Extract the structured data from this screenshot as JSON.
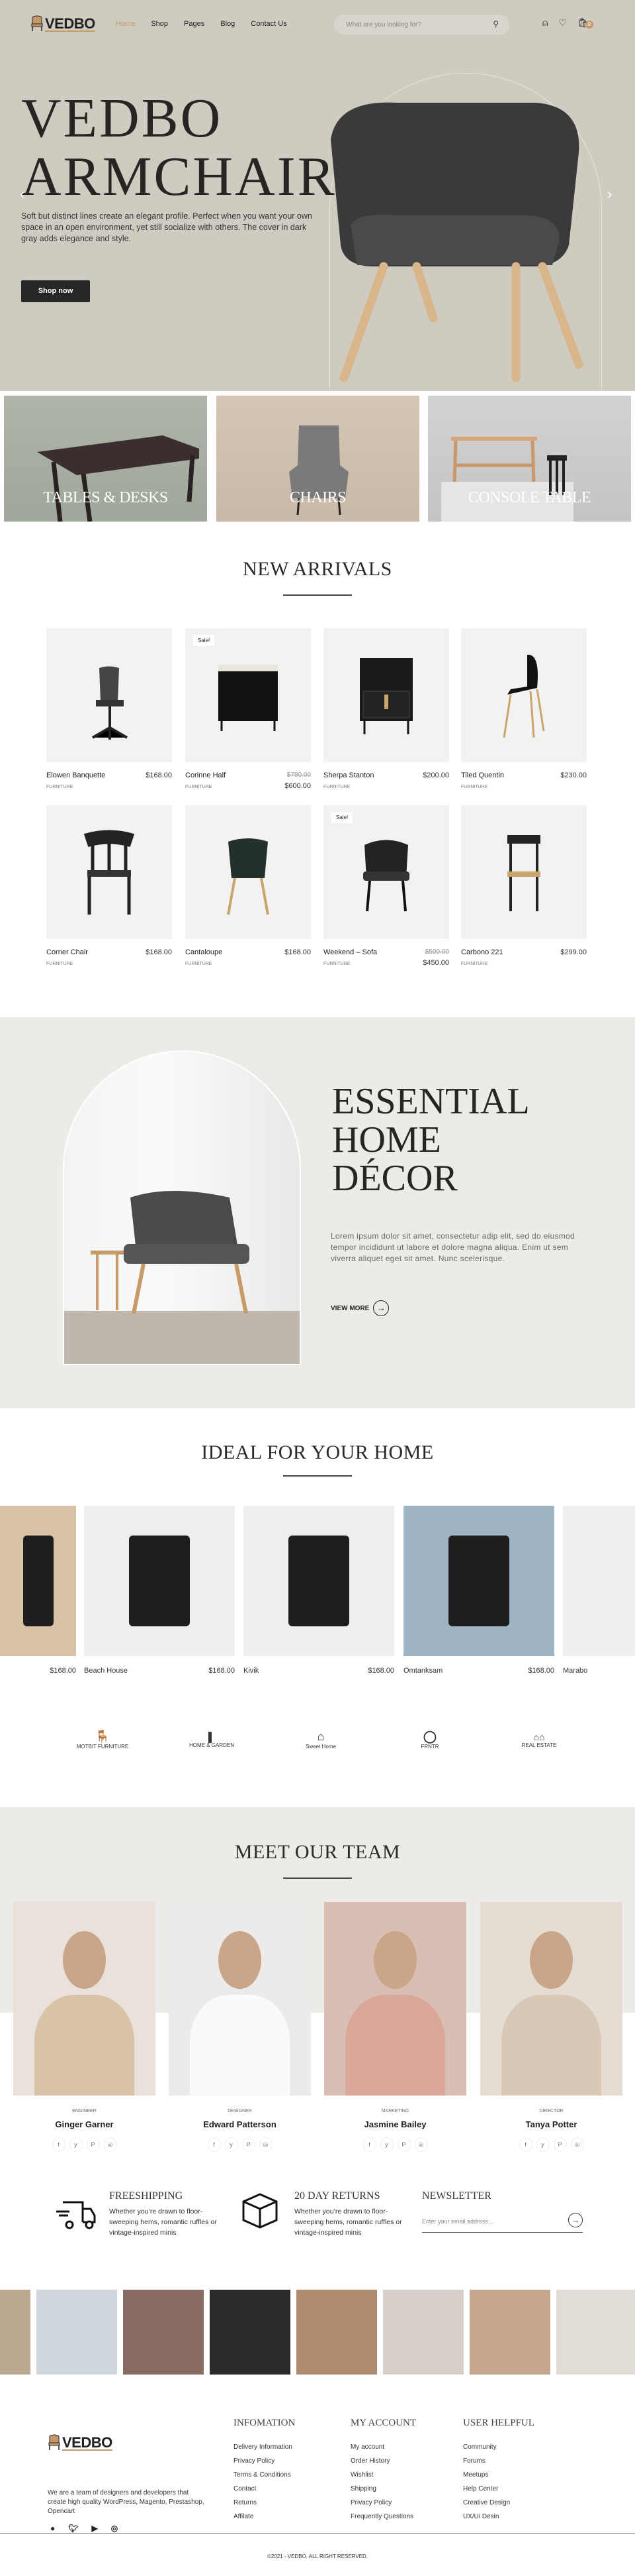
{
  "colors": {
    "accent": "#c49a6c",
    "hero_bg": "#cfcbc0",
    "section_bg": "#ecebe7",
    "dark": "#262626"
  },
  "header": {
    "logo": "VEDBO",
    "nav": [
      "Home",
      "Shop",
      "Pages",
      "Blog",
      "Contact Us"
    ],
    "active_nav": "Home",
    "search_placeholder": "What are you looking for?",
    "icons": [
      "search-icon",
      "user-icon",
      "heart-icon",
      "cart-icon"
    ],
    "cart_count": "0"
  },
  "hero": {
    "title_line1": "VEDBO",
    "title_line2": "ARMCHAIR",
    "description": "Soft but distinct lines create an elegant profile. Perfect when you want your own space in an open environment, yet still socialize with others. The cover in dark gray adds elegance and style.",
    "cta": "Shop now"
  },
  "categories": [
    "TABLES & DESKS",
    "CHAIRS",
    "CONSOLE TABLE"
  ],
  "new_arrivals": {
    "title": "NEW ARRIVALS",
    "products": [
      {
        "name": "Elowen Banquette",
        "category": "FURNITURE",
        "price": "$168.00"
      },
      {
        "name": "Corinne Half",
        "category": "FURNITURE",
        "old_price": "$780.00",
        "price": "$600.00",
        "badge": "Sale!"
      },
      {
        "name": "Sherpa Stanton",
        "category": "FURNITURE",
        "price": "$200.00"
      },
      {
        "name": "Tiled Quentin",
        "category": "FURNITURE",
        "price": "$230.00"
      },
      {
        "name": "Corner Chair",
        "category": "FURNITURE",
        "price": "$168.00"
      },
      {
        "name": "Cantaloupe",
        "category": "FURNITURE",
        "price": "$168.00"
      },
      {
        "name": "Weekend – Sofa",
        "category": "FURNITURE",
        "old_price": "$500.00",
        "price": "$450.00",
        "badge": "Sale!"
      },
      {
        "name": "Carbono 221",
        "category": "FURNITURE",
        "price": "$299.00"
      }
    ]
  },
  "decor": {
    "title_lines": [
      "ESSENTIAL",
      "HOME",
      "DÉCOR"
    ],
    "text": "Lorem ipsum dolor sit amet, consectetur adip elit, sed do eiusmod tempor incididunt ut labore et dolore magna aliqua. Enim ut sem viverra aliquet eget sit amet. Nunc scelerisque.",
    "cta": "VIEW MORE"
  },
  "ideal": {
    "title": "IDEAL FOR YOUR HOME",
    "items": [
      {
        "name": "",
        "price": "$168.00"
      },
      {
        "name": "Beach House",
        "price": "$168.00"
      },
      {
        "name": "Kivik",
        "price": "$168.00"
      },
      {
        "name": "Omtanksam",
        "price": "$168.00"
      },
      {
        "name": "Marabo",
        "price": ""
      }
    ]
  },
  "brands": [
    "MOTBIT FURNITURE",
    "HOME & GARDEN",
    "Sweet Home",
    "FRNTR",
    "REAL ESTATE"
  ],
  "team": {
    "title": "MEET OUR TEAM",
    "members": [
      {
        "role": "ENGINEER",
        "name": "Ginger Garner"
      },
      {
        "role": "DESIGNER",
        "name": "Edward Patterson"
      },
      {
        "role": "MARKETING",
        "name": "Jasmine Bailey"
      },
      {
        "role": "DIRECTOR",
        "name": "Tanya Potter"
      }
    ],
    "social": [
      "f",
      "y",
      "P",
      "◎"
    ]
  },
  "features": [
    {
      "title": "FREESHIPPING",
      "text": "Whether you’re drawn to floor-sweeping hems, romantic ruffles or vintage-inspired minis",
      "icon": "truck-icon"
    },
    {
      "title": "20 DAY RETURNS",
      "text": "Whether you’re drawn to floor-sweeping hems, romantic ruffles or vintage-inspired minis",
      "icon": "box-icon"
    }
  ],
  "newsletter": {
    "title": "NEWSLETTER",
    "placeholder": "Enter your email address..."
  },
  "footer": {
    "logo": "VEDBO",
    "about": "We are a team of designers and developers that create high quality WordPress, Magento, Prestashop, Opencart",
    "columns": [
      {
        "title": "INFOMATION",
        "links": [
          "Delivery Information",
          "Privacy Policy",
          "Terms & Conditions",
          "Contact",
          "Returns",
          "Affilate"
        ]
      },
      {
        "title": "MY ACCOUNT",
        "links": [
          "My account",
          "Order History",
          "Wishlist",
          "Shipping",
          "Privacy Policy",
          "Frequently Questions"
        ]
      },
      {
        "title": "USER HELPFUL",
        "links": [
          "Community",
          "Forums",
          "Meetups",
          "Help Center",
          "Creative Design",
          "UX/Ui Desin"
        ]
      }
    ],
    "copyright": "©2021 - VEDBO. ALL RIGHT RESERVED."
  }
}
